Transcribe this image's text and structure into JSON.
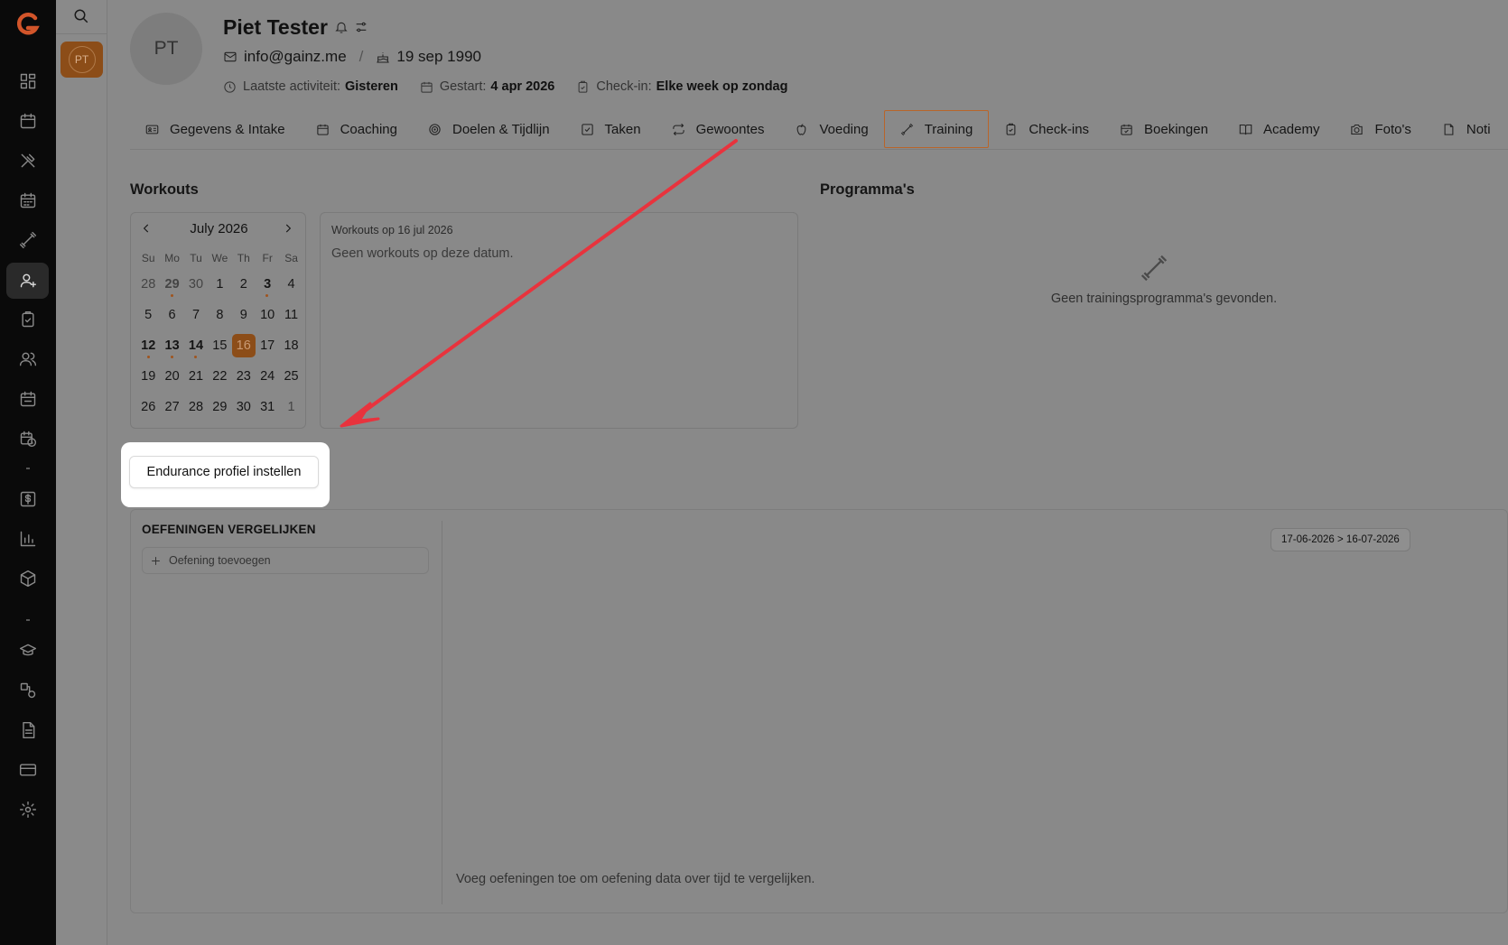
{
  "profile": {
    "initials": "PT",
    "name": "Piet Tester",
    "email": "info@gainz.me",
    "birthday": "19 sep 1990",
    "last_activity_label": "Laatste activiteit:",
    "last_activity_value": "Gisteren",
    "started_label": "Gestart:",
    "started_value": "4 apr 2026",
    "checkin_label": "Check-in:",
    "checkin_value": "Elke week op zondag"
  },
  "sidebar": {
    "selected_client_initials": "PT"
  },
  "tabs": [
    {
      "label": "Gegevens & Intake",
      "icon": "id-card-icon"
    },
    {
      "label": "Coaching",
      "icon": "calendar-icon"
    },
    {
      "label": "Doelen & Tijdlijn",
      "icon": "target-icon"
    },
    {
      "label": "Taken",
      "icon": "checkbox-icon"
    },
    {
      "label": "Gewoontes",
      "icon": "repeat-icon"
    },
    {
      "label": "Voeding",
      "icon": "apple-icon"
    },
    {
      "label": "Training",
      "icon": "dumbbell-icon",
      "active": true
    },
    {
      "label": "Check-ins",
      "icon": "clipboard-icon"
    },
    {
      "label": "Boekingen",
      "icon": "calendar-check-icon"
    },
    {
      "label": "Academy",
      "icon": "book-icon"
    },
    {
      "label": "Foto's",
      "icon": "camera-icon"
    },
    {
      "label": "Noti",
      "icon": "note-icon"
    }
  ],
  "workouts": {
    "title": "Workouts",
    "calendar": {
      "month_label": "July 2026",
      "weekdays": [
        "Su",
        "Mo",
        "Tu",
        "We",
        "Th",
        "Fr",
        "Sa"
      ],
      "days": [
        {
          "d": "28",
          "muted": true
        },
        {
          "d": "29",
          "muted": true,
          "bold": true,
          "mark": true
        },
        {
          "d": "30",
          "muted": true
        },
        {
          "d": "1"
        },
        {
          "d": "2"
        },
        {
          "d": "3",
          "bold": true,
          "mark": true
        },
        {
          "d": "4"
        },
        {
          "d": "5"
        },
        {
          "d": "6"
        },
        {
          "d": "7"
        },
        {
          "d": "8"
        },
        {
          "d": "9"
        },
        {
          "d": "10"
        },
        {
          "d": "11"
        },
        {
          "d": "12",
          "bold": true,
          "mark": true
        },
        {
          "d": "13",
          "bold": true,
          "mark": true
        },
        {
          "d": "14",
          "bold": true,
          "mark": true
        },
        {
          "d": "15"
        },
        {
          "d": "16",
          "selected": true
        },
        {
          "d": "17"
        },
        {
          "d": "18"
        },
        {
          "d": "19"
        },
        {
          "d": "20"
        },
        {
          "d": "21"
        },
        {
          "d": "22"
        },
        {
          "d": "23"
        },
        {
          "d": "24"
        },
        {
          "d": "25"
        },
        {
          "d": "26"
        },
        {
          "d": "27"
        },
        {
          "d": "28"
        },
        {
          "d": "29"
        },
        {
          "d": "30"
        },
        {
          "d": "31"
        },
        {
          "d": "1",
          "muted": true
        }
      ]
    },
    "panel_date": "Workouts op 16 jul 2026",
    "panel_empty": "Geen workouts op deze datum."
  },
  "programs": {
    "title": "Programma's",
    "empty": "Geen trainingsprogramma's gevonden."
  },
  "endurance_button": "Endurance profiel instellen",
  "compare": {
    "title": "OEFENINGEN VERGELIJKEN",
    "add_label": "Oefening toevoegen",
    "range": "17-06-2026 > 16-07-2026",
    "hint": "Voeg oefeningen toe om oefening data over tijd te vergelijken."
  },
  "colors": {
    "accent": "#8c4d18",
    "arrow": "#e8333d",
    "rail": "#0a0a0a"
  }
}
